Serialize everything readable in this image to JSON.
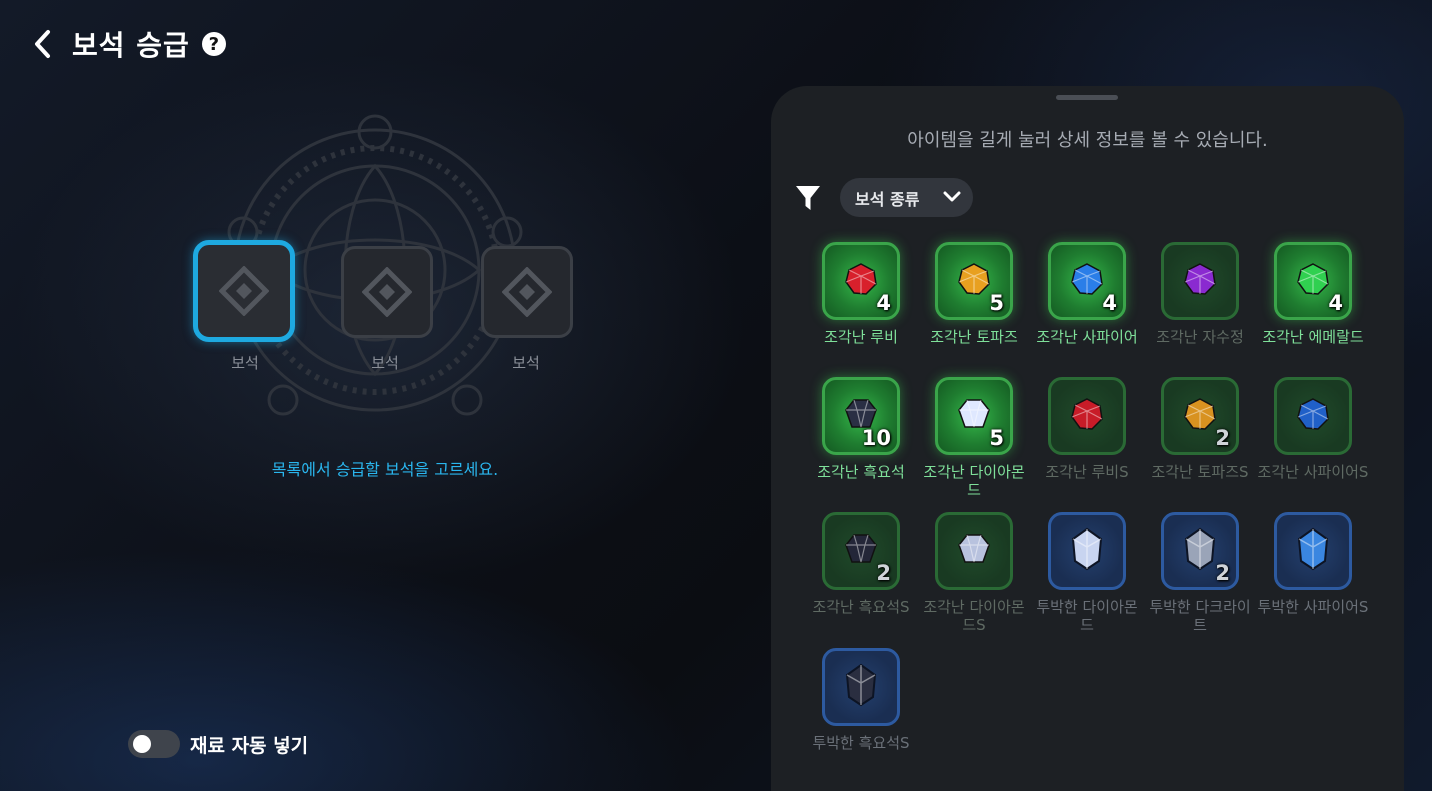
{
  "header": {
    "title": "보석 승급",
    "help": "?"
  },
  "slots": [
    {
      "label": "보석",
      "selected": true
    },
    {
      "label": "보석",
      "selected": false
    },
    {
      "label": "보석",
      "selected": false
    }
  ],
  "hint": "목록에서 승급할 보석을 고르세요.",
  "auto_fill": {
    "label": "재료 자동 넣기",
    "on": false
  },
  "panel": {
    "hint": "아이템을 길게 눌러 상세 정보를 볼 수 있습니다.",
    "filter": {
      "label": "보석 종류"
    }
  },
  "items": [
    {
      "name": "조각난 루비",
      "count": "4",
      "gem": "ruby",
      "color": "#d8202c",
      "style": "bright"
    },
    {
      "name": "조각난 토파즈",
      "count": "5",
      "gem": "topaz",
      "color": "#e8a020",
      "style": "bright"
    },
    {
      "name": "조각난 사파이어",
      "count": "4",
      "gem": "sapphire",
      "color": "#2a7ee8",
      "style": "bright"
    },
    {
      "name": "조각난 자수정",
      "count": "",
      "gem": "amethyst",
      "color": "#8a2ad0",
      "style": "dim"
    },
    {
      "name": "조각난 에메랄드",
      "count": "4",
      "gem": "emerald",
      "color": "#30d050",
      "style": "bright"
    },
    {
      "name": "조각난 흑요석",
      "count": "10",
      "gem": "obsidian",
      "color": "#2a2f44",
      "style": "bright"
    },
    {
      "name": "조각난 다이아몬드",
      "count": "5",
      "gem": "diamond",
      "color": "#dfe8ff",
      "style": "bright"
    },
    {
      "name": "조각난 루비S",
      "count": "",
      "gem": "ruby",
      "color": "#c81c28",
      "style": "dim"
    },
    {
      "name": "조각난 토파즈S",
      "count": "2",
      "gem": "topaz",
      "color": "#d89220",
      "style": "dim"
    },
    {
      "name": "조각난 사파이어S",
      "count": "",
      "gem": "sapphire",
      "color": "#2060c8",
      "style": "dim"
    },
    {
      "name": "조각난 흑요석S",
      "count": "2",
      "gem": "obsidian",
      "color": "#232638",
      "style": "dim"
    },
    {
      "name": "조각난 다이아몬드S",
      "count": "",
      "gem": "diamond",
      "color": "#b8c2de",
      "style": "dim"
    },
    {
      "name": "투박한 다이아몬드",
      "count": "",
      "gem": "crystal",
      "color": "#c8d4f0",
      "style": "blue"
    },
    {
      "name": "투박한 다크라이트",
      "count": "2",
      "gem": "crystal",
      "color": "#9aa4b8",
      "style": "blue"
    },
    {
      "name": "투박한 사파이어S",
      "count": "",
      "gem": "crystal",
      "color": "#3a86e0",
      "style": "blue"
    },
    {
      "name": "투박한 흑요석S",
      "count": "",
      "gem": "crystal",
      "color": "#2a2e40",
      "style": "blue"
    }
  ],
  "colors": {
    "accent": "#1ea9e0",
    "green_text": "#7fe09a"
  }
}
